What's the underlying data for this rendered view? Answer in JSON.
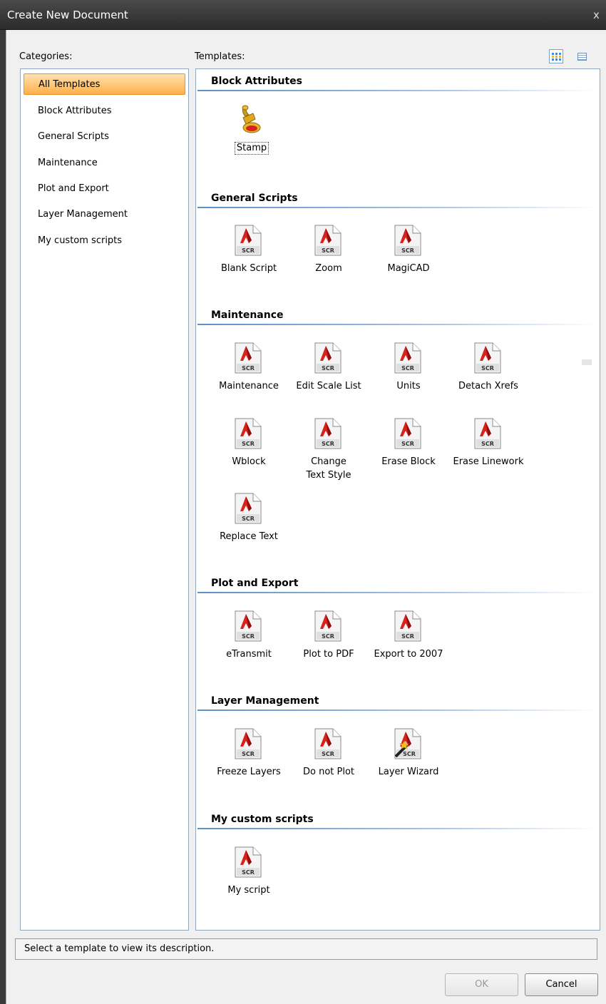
{
  "window": {
    "title": "Create New Document",
    "close_glyph": "x"
  },
  "categories": {
    "label": "Categories:",
    "items": [
      {
        "label": "All Templates",
        "selected": true
      },
      {
        "label": "Block Attributes",
        "selected": false
      },
      {
        "label": "General Scripts",
        "selected": false
      },
      {
        "label": "Maintenance",
        "selected": false
      },
      {
        "label": "Plot and Export",
        "selected": false
      },
      {
        "label": "Layer Management",
        "selected": false
      },
      {
        "label": "My custom scripts",
        "selected": false
      }
    ]
  },
  "templates": {
    "label": "Templates:",
    "view_modes": [
      "large-icons-view-icon",
      "list-view-icon"
    ],
    "groups": [
      {
        "title": "Block Attributes",
        "items": [
          {
            "label": "Stamp",
            "icon": "stamp-icon",
            "focused": true
          }
        ]
      },
      {
        "title": "General Scripts",
        "items": [
          {
            "label": "Blank Script",
            "icon": "scr-file-icon"
          },
          {
            "label": "Zoom",
            "icon": "scr-file-icon"
          },
          {
            "label": "MagiCAD",
            "icon": "scr-file-icon"
          }
        ]
      },
      {
        "title": "Maintenance",
        "items": [
          {
            "label": "Maintenance",
            "icon": "scr-file-icon"
          },
          {
            "label": "Edit Scale List",
            "icon": "scr-file-icon"
          },
          {
            "label": "Units",
            "icon": "scr-file-icon"
          },
          {
            "label": "Detach Xrefs",
            "icon": "scr-file-icon"
          },
          {
            "label": "Wblock",
            "icon": "scr-file-icon"
          },
          {
            "label": "Change Text Style",
            "icon": "scr-file-icon"
          },
          {
            "label": "Erase Block",
            "icon": "scr-file-icon"
          },
          {
            "label": "Erase Linework",
            "icon": "scr-file-icon"
          },
          {
            "label": "Replace Text",
            "icon": "scr-file-icon"
          }
        ]
      },
      {
        "title": "Plot and Export",
        "items": [
          {
            "label": "eTransmit",
            "icon": "scr-file-icon"
          },
          {
            "label": "Plot to PDF",
            "icon": "scr-file-icon"
          },
          {
            "label": "Export to 2007",
            "icon": "scr-file-icon"
          }
        ]
      },
      {
        "title": "Layer Management",
        "items": [
          {
            "label": "Freeze Layers",
            "icon": "scr-file-icon"
          },
          {
            "label": "Do not Plot",
            "icon": "scr-file-icon"
          },
          {
            "label": "Layer Wizard",
            "icon": "wizard-scr-icon"
          }
        ]
      },
      {
        "title": "My custom scripts",
        "items": [
          {
            "label": "My script",
            "icon": "scr-file-icon"
          }
        ]
      }
    ],
    "scr_badge": "SCR"
  },
  "status": {
    "text": "Select a template to view its description."
  },
  "buttons": {
    "ok": "OK",
    "cancel": "Cancel"
  },
  "colors": {
    "accent": "#ffb04a",
    "header_line": "#5d8fc9",
    "titlebar": "#2b2b2b",
    "scr_red": "#d8221c"
  }
}
